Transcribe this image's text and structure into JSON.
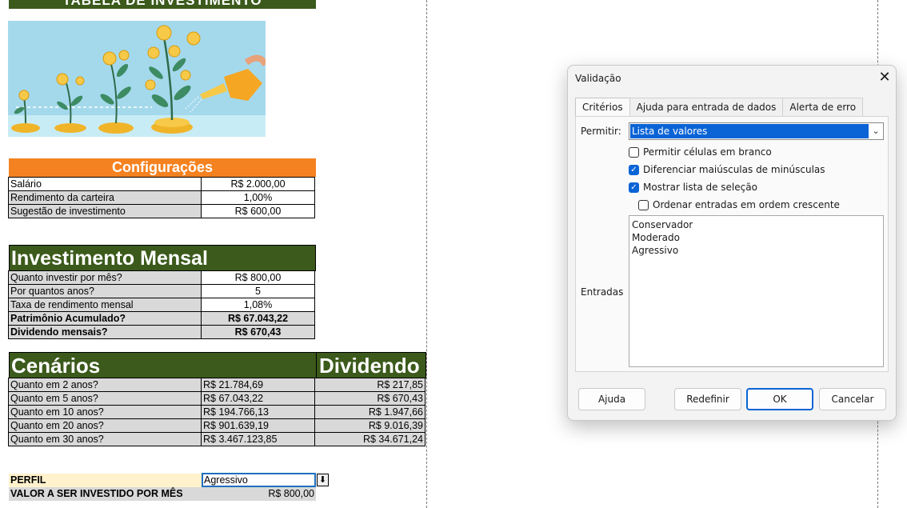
{
  "sheet": {
    "title": "TABELA DE INVESTIMENTO",
    "config": {
      "header": "Configurações",
      "rows": [
        {
          "label": "Salário",
          "value": "R$ 2.000,00"
        },
        {
          "label": "Rendimento da carteira",
          "value": "1,00%"
        },
        {
          "label": "Sugestão de investimento",
          "value": "R$ 600,00"
        }
      ]
    },
    "monthly": {
      "header": "Investimento Mensal",
      "rows": [
        {
          "label": "Quanto investir por mês?",
          "value": "R$ 800,00"
        },
        {
          "label": "Por quantos anos?",
          "value": "5"
        },
        {
          "label": "Taxa de rendimento mensal",
          "value": "1,08%"
        },
        {
          "label": "Patrimônio Acumulado?",
          "value": "R$ 67.043,22"
        },
        {
          "label": "Dividendo mensais?",
          "value": "R$ 670,43"
        }
      ]
    },
    "scenarios": {
      "header": "Cenários",
      "header2": "Dividendo",
      "rows": [
        {
          "label": "Quanto em 2 anos?",
          "value": "R$ 21.784,69",
          "dividend": "R$ 217,85"
        },
        {
          "label": "Quanto em 5 anos?",
          "value": "R$ 67.043,22",
          "dividend": "R$ 670,43"
        },
        {
          "label": "Quanto em 10 anos?",
          "value": "R$ 194.766,13",
          "dividend": "R$ 1.947,66"
        },
        {
          "label": "Quanto em 20 anos?",
          "value": "R$ 901.639,19",
          "dividend": "R$ 9.016,39"
        },
        {
          "label": "Quanto em 30 anos?",
          "value": "R$ 3.467.123,85",
          "dividend": "R$ 34.671,24"
        }
      ]
    },
    "perfil": {
      "label": "PERFIL",
      "value": "Agressivo"
    },
    "valor": {
      "label": "VALOR A SER INVESTIDO POR MÊS",
      "value": "R$ 800,00"
    }
  },
  "dialog": {
    "title": "Validação",
    "tabs": [
      "Critérios",
      "Ajuda para entrada de dados",
      "Alerta de erro"
    ],
    "permitir_label": "Permitir:",
    "permitir_value": "Lista de valores",
    "checkboxes": [
      {
        "label": "Permitir células em branco",
        "checked": false
      },
      {
        "label": "Diferenciar maiúsculas de minúsculas",
        "checked": true
      },
      {
        "label": "Mostrar lista de seleção",
        "checked": true
      },
      {
        "label": "Ordenar entradas em ordem crescente",
        "checked": false
      }
    ],
    "entradas_label": "Entradas",
    "entries": [
      "Conservador",
      "Moderado",
      "Agressivo"
    ],
    "buttons": {
      "help": "Ajuda",
      "reset": "Redefinir",
      "ok": "OK",
      "cancel": "Cancelar"
    }
  },
  "colors": {
    "sheet_green": "#3b5a1b",
    "config_orange": "#f58220",
    "accent_blue": "#0a64d6"
  }
}
